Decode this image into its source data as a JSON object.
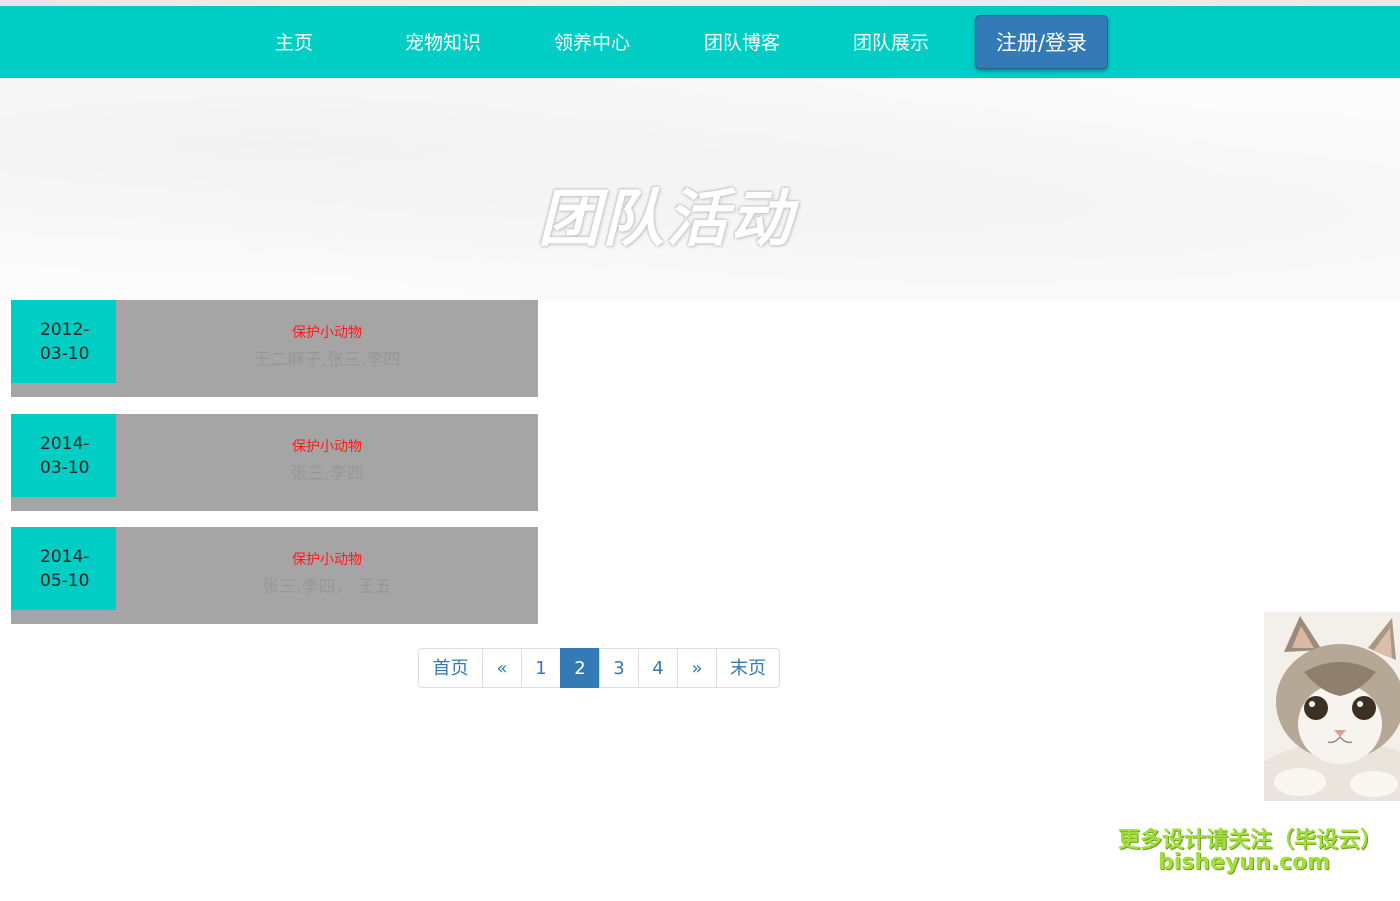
{
  "nav": {
    "items": [
      {
        "label": "主页"
      },
      {
        "label": "宠物知识"
      },
      {
        "label": "领养中心"
      },
      {
        "label": "团队博客"
      },
      {
        "label": "团队展示"
      }
    ],
    "login_label": "注册/登录",
    "accent_color": "#00cdc4",
    "login_color": "#337ab7"
  },
  "hero": {
    "title": "团队活动"
  },
  "activities": [
    {
      "date_line1": "2012-",
      "date_line2": "03-10",
      "title": "保护小动物",
      "members": "王二麻子,张三,李四"
    },
    {
      "date_line1": "2014-",
      "date_line2": "03-10",
      "title": "保护小动物",
      "members": "张三,李四"
    },
    {
      "date_line1": "2014-",
      "date_line2": "05-10",
      "title": "保护小动物",
      "members": "张三,李四， 王五"
    }
  ],
  "pagination": {
    "first": "首页",
    "prev": "«",
    "pages": [
      "1",
      "2",
      "3",
      "4"
    ],
    "current_page": "2",
    "next": "»",
    "last": "末页"
  },
  "sidebar_image": {
    "icon": "cat-photo"
  },
  "watermark": {
    "line1": "更多设计请关注（毕设云）",
    "line2": "bisheyun.com"
  }
}
